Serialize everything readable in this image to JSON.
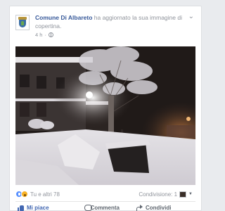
{
  "post": {
    "page_name": "Comune Di Albareto",
    "action_text": "ha aggiornato la sua immagine di copertina.",
    "time": "4 h"
  },
  "footer": {
    "reactions_text": "Tu e altri 78",
    "shares_text": "Condivisione: 1",
    "like_label": "Mi piace",
    "comment_label": "Commenta",
    "share_label": "Condividi"
  },
  "colors": {
    "link": "#365899",
    "like_active": "#4267b2",
    "muted": "#90949c"
  },
  "icons": [
    "avatar-crest-icon",
    "globe-icon",
    "chevron-down-icon",
    "like-reaction-icon",
    "wow-reaction-icon",
    "thumb-up-icon",
    "comment-icon",
    "share-icon"
  ]
}
